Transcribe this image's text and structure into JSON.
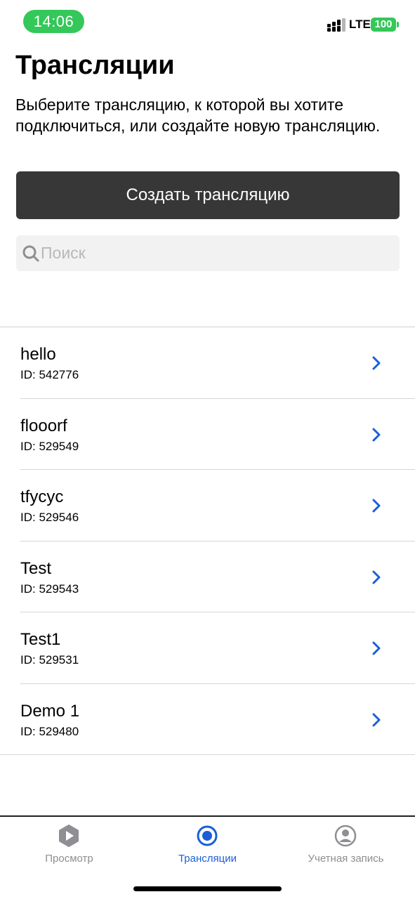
{
  "status_bar": {
    "time": "14:06",
    "network": "LTE",
    "battery": "100"
  },
  "header": {
    "title": "Трансляции",
    "subtitle": "Выберите трансляцию, к которой вы хотите подключиться, или создайте новую трансляцию."
  },
  "create_button": {
    "label": "Создать трансляцию"
  },
  "search": {
    "placeholder": "Поиск",
    "value": ""
  },
  "broadcasts": [
    {
      "name": "hello",
      "id": "ID: 542776"
    },
    {
      "name": "flooorf",
      "id": "ID: 529549"
    },
    {
      "name": "tfycyc",
      "id": "ID: 529546"
    },
    {
      "name": "Test",
      "id": "ID: 529543"
    },
    {
      "name": "Test1",
      "id": "ID: 529531"
    },
    {
      "name": "Demo 1",
      "id": "ID: 529480"
    }
  ],
  "tab_bar": {
    "active": "broadcasts",
    "tabs": [
      {
        "key": "watch",
        "label": "Просмотр",
        "icon": "play-icon"
      },
      {
        "key": "broadcasts",
        "label": "Трансляции",
        "icon": "broadcast-icon"
      },
      {
        "key": "account",
        "label": "Учетная запись",
        "icon": "user-icon"
      }
    ]
  },
  "colors": {
    "accent": "#1a5fd6",
    "status_green": "#34c759",
    "button_bg": "#373737",
    "inactive_tab": "#8e8e93"
  }
}
